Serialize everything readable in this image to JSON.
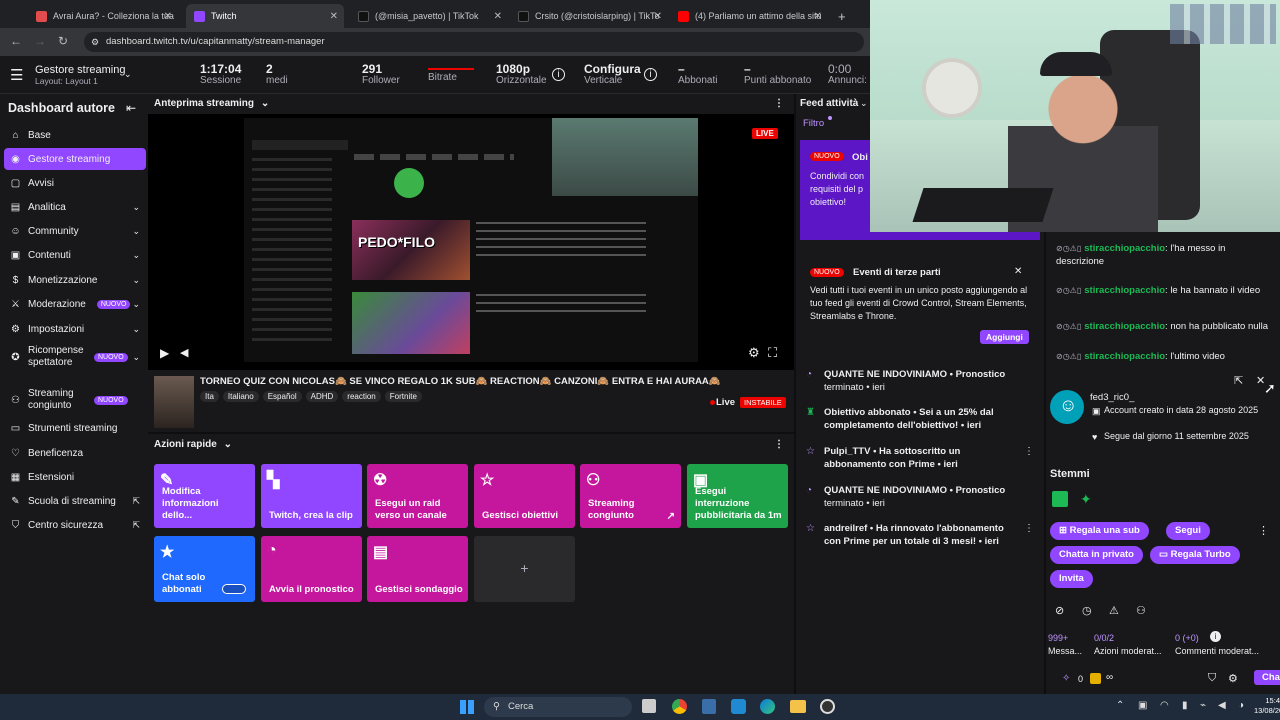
{
  "browser": {
    "tabs": [
      {
        "label": "Avrai Aura? - Colleziona la tua",
        "color": "#e34c4c"
      },
      {
        "label": "Twitch",
        "color": "#9147ff"
      },
      {
        "label": "(@misia_pavetto) | TikTok",
        "color": "#111111"
      },
      {
        "label": "Crsito (@cristoislarping) | TikTo",
        "color": "#111111"
      },
      {
        "label": "(4) Parliamo un attimo della situ",
        "color": "#ff0000"
      }
    ],
    "new_tab": "+",
    "url": "dashboard.twitch.tv/u/capitanmatty/stream-manager"
  },
  "topbar": {
    "title": "Gestore streaming",
    "layout": "Layout: Layout 1",
    "stats": [
      {
        "value": "1:17:04",
        "label": "Sessione"
      },
      {
        "value": "2",
        "label": "medi"
      },
      {
        "value": "291",
        "label": "Follower"
      },
      {
        "value": "",
        "label": "Bitrate"
      },
      {
        "value": "1080p",
        "label": "Orizzontale"
      },
      {
        "value": "Configura",
        "label": "Verticale"
      },
      {
        "value": "–",
        "label": "Abbonati"
      },
      {
        "value": "–",
        "label": "Punti abbonato"
      },
      {
        "value": "0:00",
        "label": "Annunci:"
      }
    ]
  },
  "sidebar": {
    "title": "Dashboard autore",
    "items": [
      {
        "label": "Base",
        "icon": "home-icon",
        "glyph": "⌂",
        "chevron": false,
        "new": false,
        "external": false
      },
      {
        "label": "Gestore streaming",
        "icon": "stream-icon",
        "glyph": "◉",
        "chevron": false,
        "new": false,
        "external": false,
        "active": true
      },
      {
        "label": "Avvisi",
        "icon": "alert-icon",
        "glyph": "▢",
        "chevron": false,
        "new": false,
        "external": false
      },
      {
        "label": "Analitica",
        "icon": "chart-icon",
        "glyph": "▤",
        "chevron": true,
        "new": false,
        "external": false
      },
      {
        "label": "Community",
        "icon": "community-icon",
        "glyph": "☺",
        "chevron": true,
        "new": false,
        "external": false
      },
      {
        "label": "Contenuti",
        "icon": "content-icon",
        "glyph": "▣",
        "chevron": true,
        "new": false,
        "external": false
      },
      {
        "label": "Monetizzazione",
        "icon": "money-icon",
        "glyph": "$",
        "chevron": true,
        "new": false,
        "external": false
      },
      {
        "label": "Moderazione",
        "icon": "sword-icon",
        "glyph": "⚔",
        "chevron": true,
        "new": true,
        "external": false
      },
      {
        "label": "Impostazioni",
        "icon": "gear-icon",
        "glyph": "⚙",
        "chevron": true,
        "new": false,
        "external": false
      },
      {
        "label": "Ricompense spettatore",
        "icon": "reward-icon",
        "glyph": "✪",
        "chevron": true,
        "new": true,
        "external": false
      },
      {
        "label": "Streaming congiunto",
        "icon": "collab-icon",
        "glyph": "⚇",
        "chevron": false,
        "new": true,
        "external": false
      },
      {
        "label": "Strumenti streaming",
        "icon": "tools-icon",
        "glyph": "▭",
        "chevron": false,
        "new": false,
        "external": false
      },
      {
        "label": "Beneficenza",
        "icon": "charity-icon",
        "glyph": "♡",
        "chevron": false,
        "new": false,
        "external": false
      },
      {
        "label": "Estensioni",
        "icon": "extension-icon",
        "glyph": "▦",
        "chevron": false,
        "new": false,
        "external": false
      },
      {
        "label": "Scuola di streaming",
        "icon": "school-icon",
        "glyph": "✎",
        "chevron": false,
        "new": false,
        "external": true
      },
      {
        "label": "Centro sicurezza",
        "icon": "shield-icon",
        "glyph": "⛉",
        "chevron": false,
        "new": false,
        "external": true
      }
    ],
    "new_label": "NUOVO"
  },
  "preview": {
    "title": "Anteprima streaming",
    "live_badge": "LIVE",
    "overlay_text": "PEDO*FILO"
  },
  "stream_info": {
    "title": "TORNEO QUIZ CON NICOLAS🙈 SE VINCO REGALO 1K SUB🙈 REACTION🙈 CANZONI🙈 ENTRA E HAI AURAA🙈",
    "tags": [
      "Ita",
      "Italiano",
      "Español",
      "ADHD",
      "reaction",
      "Fortnite"
    ],
    "live_label": "Live",
    "status": "INSTABILE"
  },
  "quick_actions": {
    "title": "Azioni rapide",
    "items": [
      {
        "label": "Modifica informazioni dello...",
        "icon": "pencil-icon",
        "glyph": "✎",
        "color": "#9147ff"
      },
      {
        "label": "Twitch, crea la clip",
        "icon": "clip-icon",
        "glyph": "▚",
        "color": "#9147ff"
      },
      {
        "label": "Esegui un raid verso un canale",
        "icon": "raid-icon",
        "glyph": "☢",
        "color": "#c5179d"
      },
      {
        "label": "Gestisci obiettivi",
        "icon": "star-icon",
        "glyph": "☆",
        "color": "#c5179d"
      },
      {
        "label": "Streaming congiunto",
        "icon": "add-user-icon",
        "glyph": "⚇",
        "color": "#c5179d"
      },
      {
        "label": "Esegui interruzione pubblicitaria da 1m",
        "icon": "ad-icon",
        "glyph": "▣",
        "color": "#1fa34a"
      },
      {
        "label": "Chat solo abbonati",
        "icon": "star-filled-icon",
        "glyph": "★",
        "color": "#1f69ff"
      },
      {
        "label": "Avvia il pronostico",
        "icon": "prediction-icon",
        "glyph": "◔",
        "color": "#c5179d"
      },
      {
        "label": "Gestisci sondaggio",
        "icon": "poll-icon",
        "glyph": "▤",
        "color": "#c5179d"
      }
    ],
    "add": "+"
  },
  "feed": {
    "title": "Feed attività",
    "filter": "Filtro",
    "promo1": {
      "badge": "NUOVO",
      "title": "Obi",
      "text": "Condividi con requisiti del p obiettivo!"
    },
    "promo2": {
      "badge": "NUOVO",
      "title": "Eventi di terze parti",
      "text": "Vedi tutti i tuoi eventi in un unico posto aggiungendo al tuo feed gli eventi di Crowd Control, Stream Elements, Streamlabs e Throne.",
      "button": "Aggiungi"
    },
    "events": [
      {
        "icon": "prediction-icon",
        "glyph": "◔",
        "title": "QUANTE NE INDOVINIAMO • Pronostico",
        "sub": "terminato • ieri"
      },
      {
        "icon": "trophy-icon",
        "glyph": "♜",
        "title": "Obiettivo abbonato • Sei a un 25% dal completamento dell'obiettivo! • ieri",
        "sub": ""
      },
      {
        "icon": "star-icon",
        "glyph": "☆",
        "title": "Pulpi_TTV • Ha sottoscritto un abbonamento con Prime • ieri",
        "sub": ""
      },
      {
        "icon": "prediction-icon",
        "glyph": "◔",
        "title": "QUANTE NE INDOVINIAMO • Pronostico",
        "sub": "terminato • ieri"
      },
      {
        "icon": "star-icon",
        "glyph": "☆",
        "title": "andreilref • Ha rinnovato l'abbonamento con Prime per un totale di 3 mesi! • ieri",
        "sub": ""
      }
    ]
  },
  "chat": {
    "lines": [
      {
        "user": "stiracchiopacchio",
        "text": ": l'ha messo in descrizione"
      },
      {
        "user": "stiracchiopacchio",
        "text": ": le ha bannato il video"
      },
      {
        "user": "stiracchiopacchio",
        "text": ": non ha pubblicato nulla"
      },
      {
        "user": "stiracchiopacchio",
        "text": ": l'ultimo video"
      }
    ],
    "profile": {
      "name": "fed3_ric0_",
      "created": "Account creato in data 28 agosto 2025",
      "follows": "Segue dal giorno 11 settembre 2025"
    },
    "badges_title": "Stemmi",
    "buttons": [
      "Regala una sub",
      "Segui",
      "Chatta in privato",
      "Regala Turbo",
      "Invita"
    ],
    "mod_stats": [
      {
        "value": "999+",
        "label": "Messa..."
      },
      {
        "value": "0/0/2",
        "label": "Azioni moderat..."
      },
      {
        "value": "0 (+0)",
        "label": "Commenti moderat..."
      }
    ],
    "bottom_count": "0",
    "chat_button": "Chat"
  },
  "taskbar": {
    "search": "Cerca",
    "time": "15:4",
    "date": "13/08/20"
  }
}
